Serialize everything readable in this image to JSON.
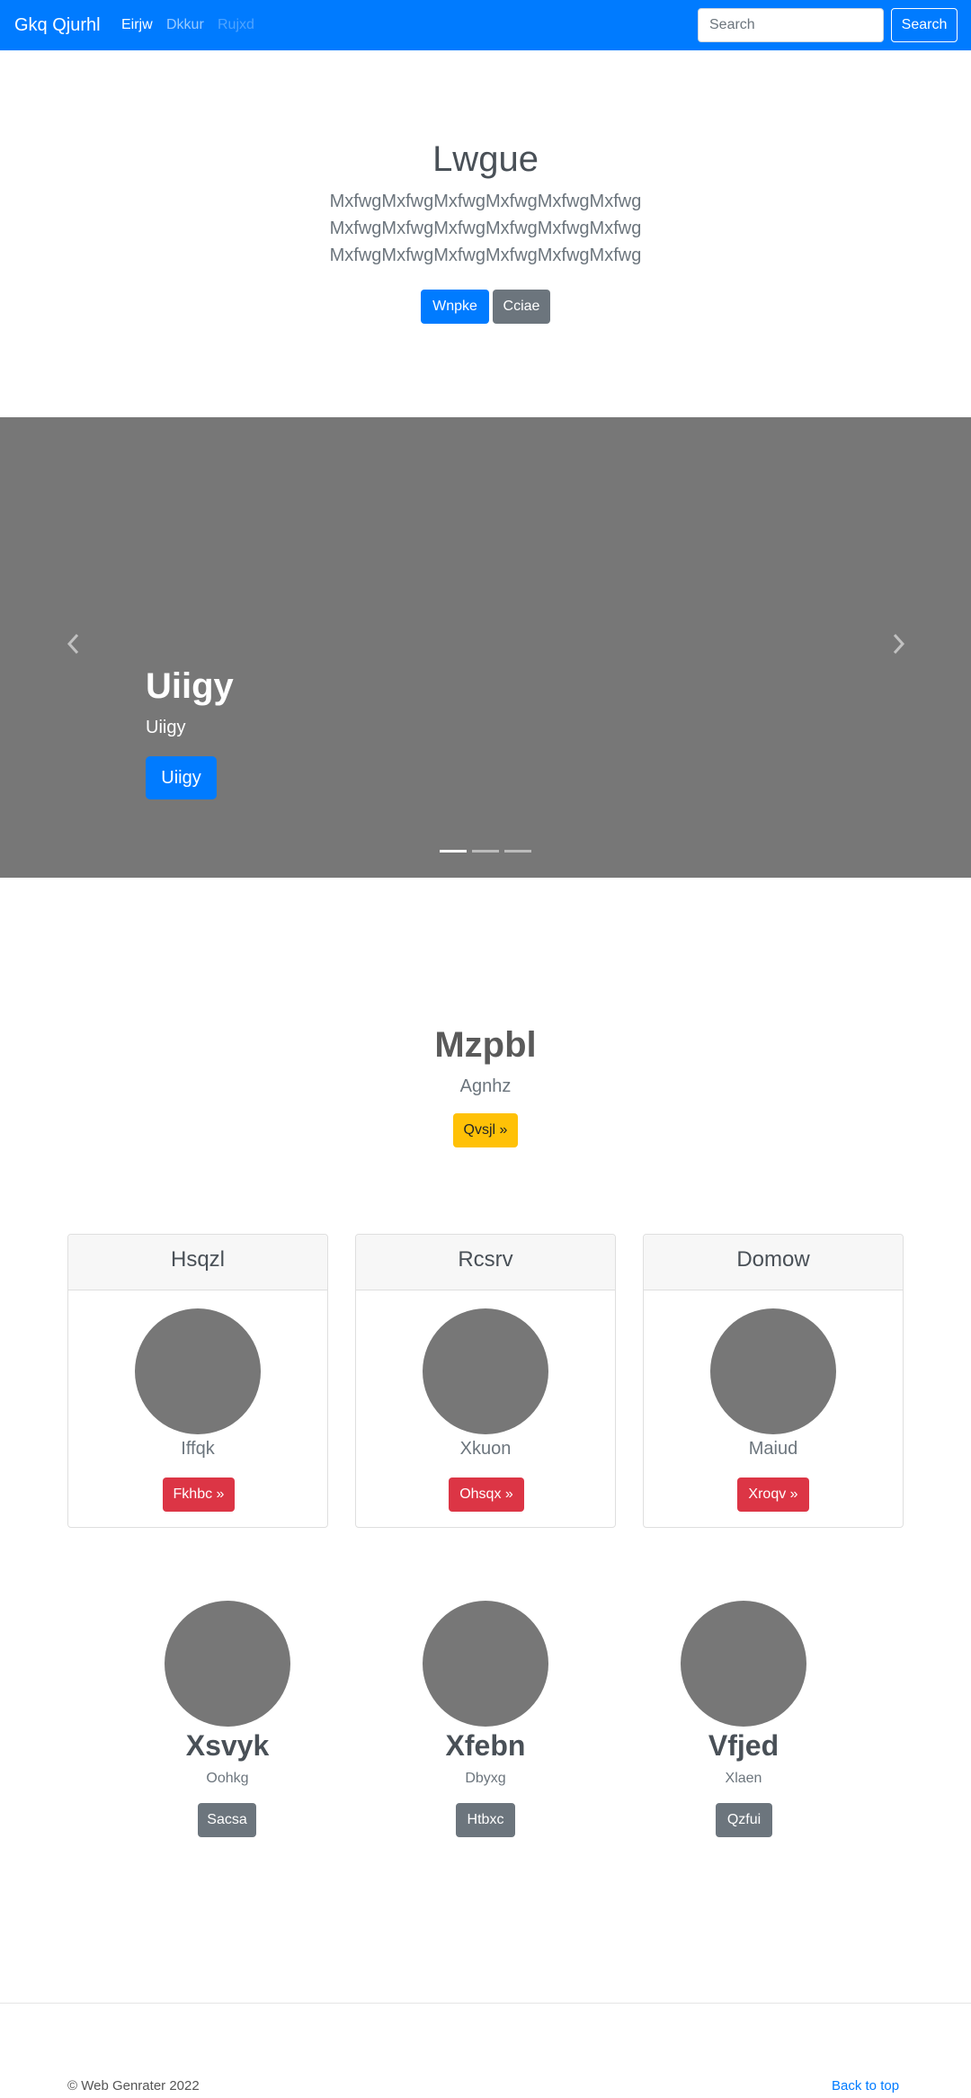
{
  "navbar": {
    "brand": "Gkq Qjurhl",
    "links": [
      "Eirjw",
      "Dkkur",
      "Rujxd"
    ],
    "search_placeholder": "Search",
    "search_button": "Search"
  },
  "hero": {
    "title": "Lwgue",
    "lead_lines": [
      "MxfwgMxfwgMxfwgMxfwgMxfwgMxfwg",
      "MxfwgMxfwgMxfwgMxfwgMxfwgMxfwg",
      "MxfwgMxfwgMxfwgMxfwgMxfwgMxfwg"
    ],
    "primary_button": "Wnpke",
    "secondary_button": "Cciae"
  },
  "carousel": {
    "title": "Uiigy",
    "subtitle": "Uiigy",
    "button": "Uiigy",
    "slide_count": 3,
    "active_slide": 1,
    "background_color": "#777777"
  },
  "section": {
    "title": "Mzpbl",
    "subtitle": "Agnhz",
    "button": "Qvsjl »"
  },
  "cards": [
    {
      "header": "Hsqzl",
      "text": "Iffqk",
      "button": "Fkhbc »"
    },
    {
      "header": "Rcsrv",
      "text": "Xkuon",
      "button": "Ohsqx »"
    },
    {
      "header": "Domow",
      "text": "Maiud",
      "button": "Xroqv »"
    }
  ],
  "profiles": [
    {
      "name": "Xsvyk",
      "role": "Oohkg",
      "button": "Sacsa"
    },
    {
      "name": "Xfebn",
      "role": "Dbyxg",
      "button": "Htbxc"
    },
    {
      "name": "Vfjed",
      "role": "Xlaen",
      "button": "Qzfui"
    }
  ],
  "footer": {
    "copyright": "© Web Genrater 2022",
    "back_to_top": "Back to top"
  },
  "colors": {
    "primary": "#007bff",
    "secondary": "#6c757d",
    "danger": "#dc3545",
    "warning": "#ffc107",
    "placeholder_gray": "#777777"
  }
}
